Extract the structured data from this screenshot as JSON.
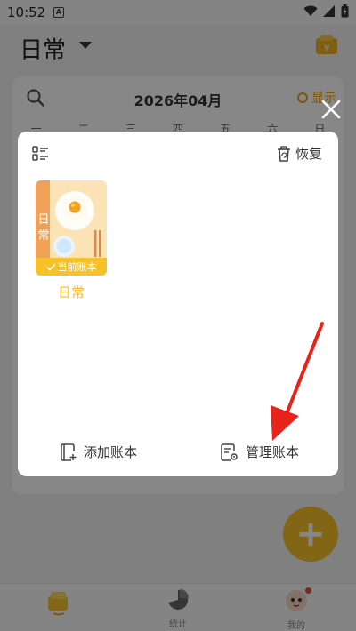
{
  "status_bar": {
    "time": "10:52",
    "notif_letter": "A"
  },
  "header": {
    "title": "日常"
  },
  "calendar": {
    "month": "2026年04月",
    "show_label": "显示",
    "weekdays": [
      "一",
      "二",
      "三",
      "四",
      "五",
      "六",
      "日"
    ]
  },
  "fab": {
    "label": "+"
  },
  "bottom_nav": {
    "stats_label": "统计",
    "me_label": "我的"
  },
  "modal": {
    "restore_label": "恢复",
    "books": [
      {
        "name": "日常",
        "spine_text": "日常",
        "current_tag": "当前账本"
      }
    ],
    "add_label": "添加账本",
    "manage_label": "管理账本"
  },
  "colors": {
    "accent": "#f6c22a",
    "spine": "#f0a057",
    "annotation_arrow": "#e8231a"
  }
}
